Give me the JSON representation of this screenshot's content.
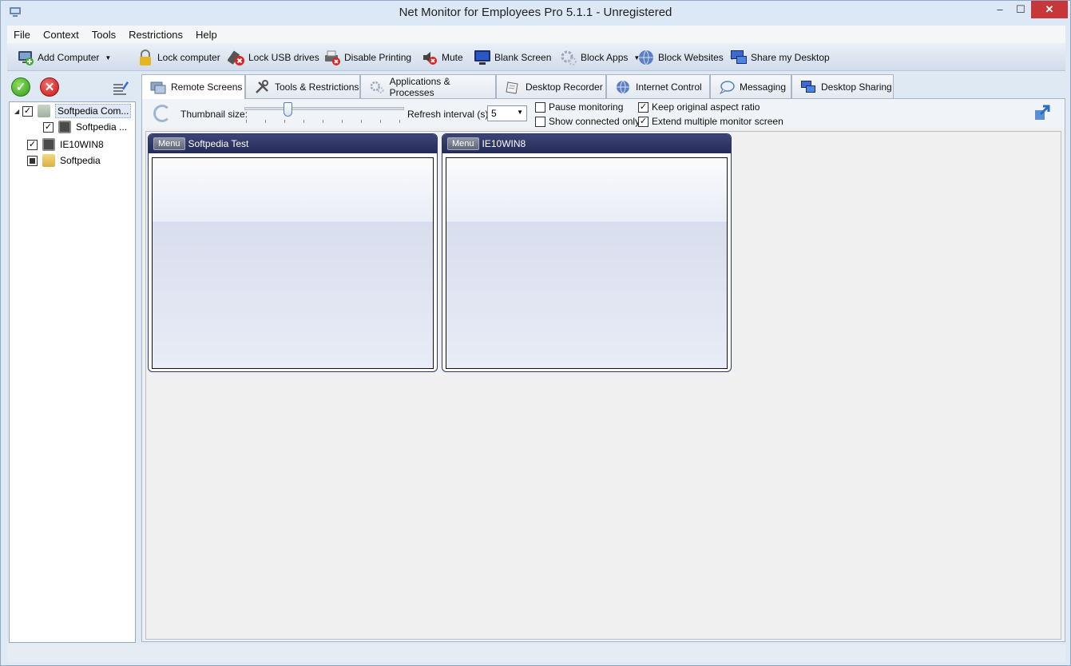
{
  "window": {
    "title": "Net Monitor for Employees Pro 5.1.1 - Unregistered"
  },
  "window_controls": {
    "minimize": "–",
    "maximize": "☐",
    "close": "✕"
  },
  "menu": [
    "File",
    "Context",
    "Tools",
    "Restrictions",
    "Help"
  ],
  "toolbar": {
    "add_computer": "Add Computer",
    "lock_computer": "Lock computer",
    "lock_usb": "Lock USB drives",
    "disable_printing": "Disable Printing",
    "mute": "Mute",
    "blank_screen": "Blank Screen",
    "block_apps": "Block Apps",
    "block_websites": "Block Websites",
    "share_desktop": "Share my Desktop"
  },
  "tree": {
    "items": [
      {
        "label": "Softpedia Com...",
        "checked": "✓",
        "type": "group",
        "expanded": "◢"
      },
      {
        "label": "Softpedia ...",
        "checked": "✓",
        "type": "computer"
      },
      {
        "label": "IE10WIN8",
        "checked": "✓",
        "type": "computer"
      },
      {
        "label": "Softpedia",
        "checked": "",
        "type": "folder"
      }
    ]
  },
  "tabs": [
    {
      "label": "Remote Screens",
      "icon": "remote-screens-icon"
    },
    {
      "label": "Tools & Restrictions",
      "icon": "tools-icon"
    },
    {
      "label": "Applications & Processes",
      "icon": "gears-icon"
    },
    {
      "label": "Desktop Recorder",
      "icon": "recorder-icon"
    },
    {
      "label": "Internet Control",
      "icon": "globe-icon"
    },
    {
      "label": "Messaging",
      "icon": "chat-icon"
    },
    {
      "label": "Desktop Sharing",
      "icon": "desktop-sharing-icon"
    }
  ],
  "controls": {
    "thumbnail_size_label": "Thumbnail size:",
    "thumbnail_size_level": 0.27,
    "refresh_label": "Refresh interval (s):",
    "refresh_value": "5",
    "pause_monitoring": {
      "label": "Pause monitoring",
      "checked": ""
    },
    "show_connected_only": {
      "label": "Show connected only",
      "checked": ""
    },
    "keep_aspect": {
      "label": "Keep original aspect ratio",
      "checked": "✓"
    },
    "extend_monitor": {
      "label": "Extend multiple monitor screen",
      "checked": "✓"
    }
  },
  "screens": [
    {
      "menu": "Menu",
      "name": "Softpedia Test"
    },
    {
      "menu": "Menu",
      "name": "IE10WIN8"
    }
  ],
  "colors": {
    "thumb_header": "#2c3466",
    "close_button": "#c7373a",
    "ok_green": "#2e9a1a",
    "cancel_red": "#c41616"
  }
}
